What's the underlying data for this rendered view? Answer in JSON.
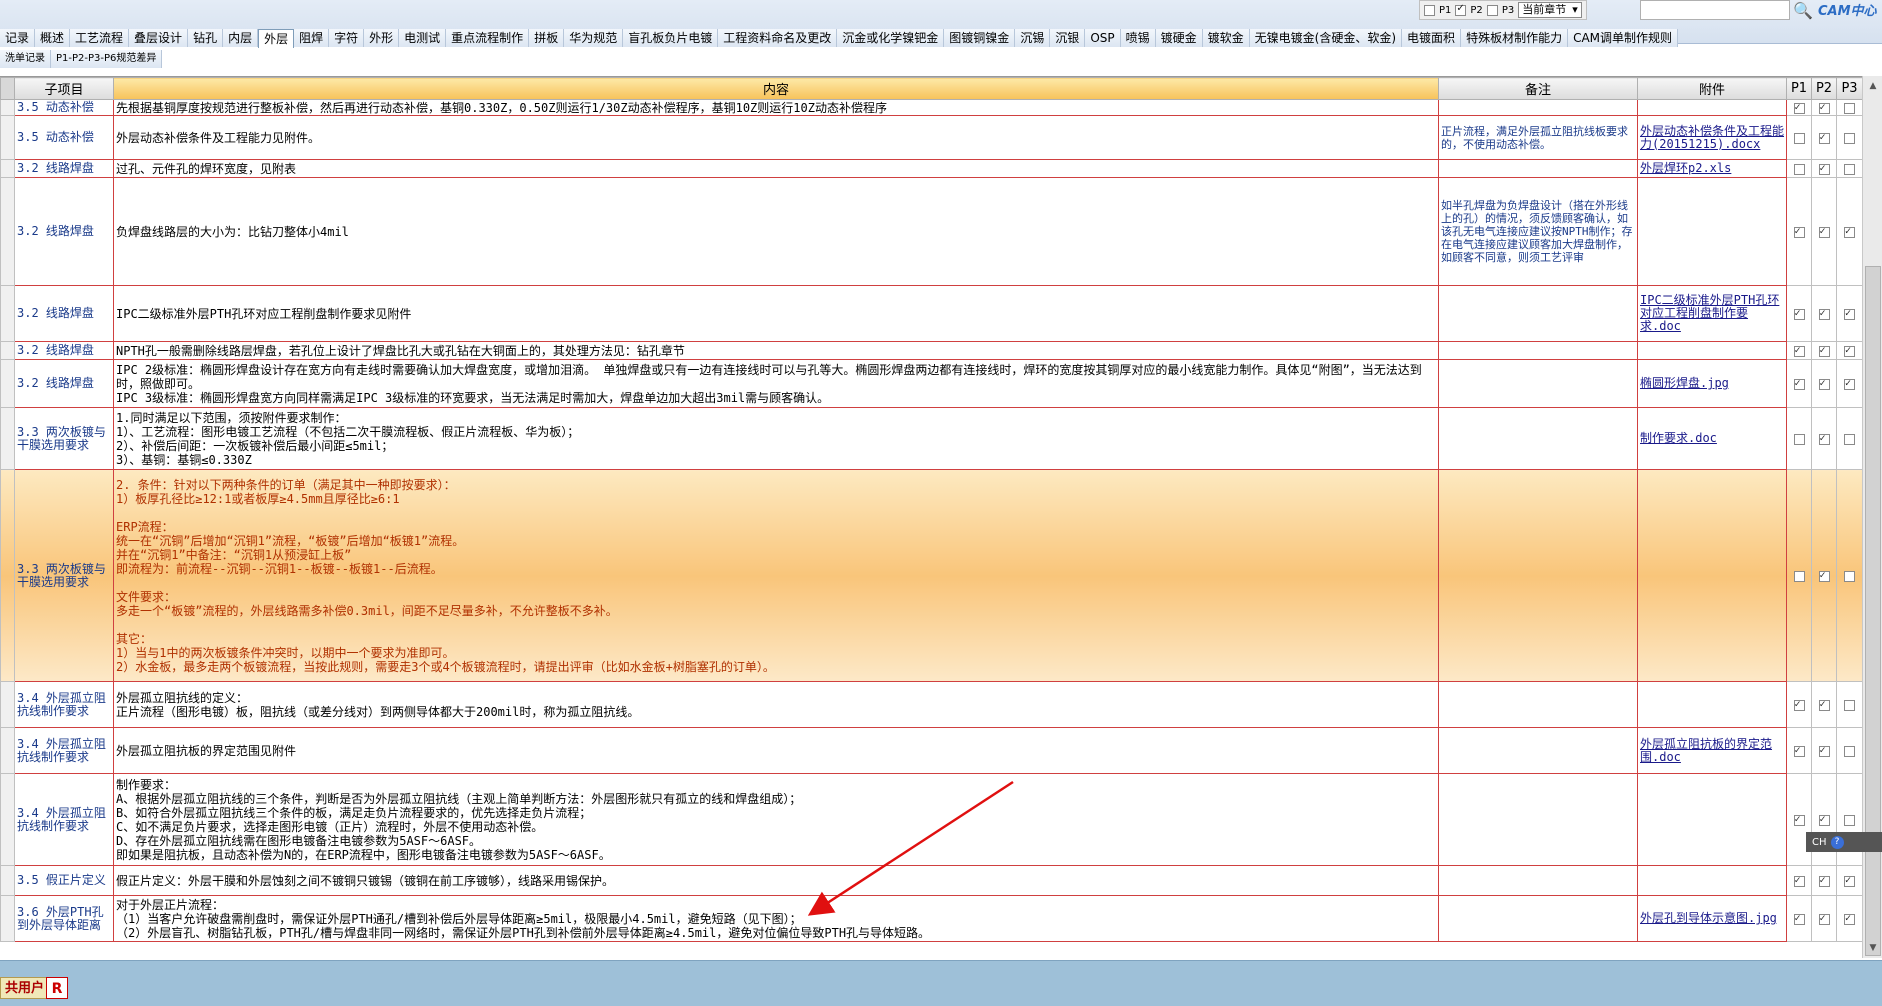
{
  "toolbar": {
    "p1_label": "P1",
    "p2_label": "P2",
    "p3_label": "P3",
    "p1_checked": false,
    "p2_checked": true,
    "p3_checked": false,
    "chapter_select": "当前章节",
    "logo_text": "CAM中心"
  },
  "tabs_row1": [
    "记录",
    "概述",
    "工艺流程",
    "叠层设计",
    "钻孔",
    "内层",
    "外层",
    "阻焊",
    "字符",
    "外形",
    "电测试",
    "重点流程制作",
    "拼板",
    "华为规范",
    "盲孔板负片电镀",
    "工程资料命名及更改",
    "沉金或化学镍钯金",
    "图镀铜镍金",
    "沉锡",
    "沉银",
    "OSP",
    "喷锡",
    "镀硬金",
    "镀软金",
    "无镍电镀金(含硬金、软金)",
    "电镀面积",
    "特殊板材制作能力",
    "CAM调单制作规则"
  ],
  "tabs_row1_active": "外层",
  "tabs_row2": [
    "洗单记录",
    "P1-P2-P3-P6规范差异"
  ],
  "table": {
    "headers": {
      "sub": "子项目",
      "content": "内容",
      "note": "备注",
      "attachment": "附件",
      "p1": "P1",
      "p2": "P2",
      "p3": "P3"
    },
    "rows": [
      {
        "sub": "3.5 动态补偿",
        "content": "先根据基铜厚度按规范进行整板补偿，然后再进行动态补偿，基铜0.330Z，0.50Z则运行1/30Z动态补偿程序，基铜10Z则运行10Z动态补偿程序",
        "note": "",
        "attachment": "",
        "p1": true,
        "p2": true,
        "p3": false
      },
      {
        "sub": "3.5 动态补偿",
        "content": "外层动态补偿条件及工程能力见附件。",
        "note": "正片流程，满足外层孤立阻抗线板要求的，不使用动态补偿。",
        "attachment": "外层动态补偿条件及工程能力(20151215).docx",
        "p1": false,
        "p2": true,
        "p3": false
      },
      {
        "sub": "3.2 线路焊盘",
        "content": "过孔、元件孔的焊环宽度，见附表",
        "note": "",
        "attachment": "外层焊环p2.xls",
        "p1": false,
        "p2": true,
        "p3": false
      },
      {
        "sub": "3.2 线路焊盘",
        "content": "负焊盘线路层的大小为：比钻刀整体小4mil",
        "note": "如半孔焊盘为负焊盘设计（搭在外形线上的孔）的情况，须反馈顾客确认，如该孔无电气连接应建议按NPTH制作；存在电气连接应建议顾客加大焊盘制作，如顾客不同意，则须工艺评审",
        "attachment": "",
        "p1": true,
        "p2": true,
        "p3": true
      },
      {
        "sub": "3.2 线路焊盘",
        "content": "IPC二级标准外层PTH孔环对应工程削盘制作要求见附件",
        "note": "",
        "attachment": "IPC二级标准外层PTH孔环对应工程削盘制作要求.doc",
        "p1": true,
        "p2": true,
        "p3": true
      },
      {
        "sub": "3.2 线路焊盘",
        "content": "NPTH孔一般需删除线路层焊盘，若孔位上设计了焊盘比孔大或孔钻在大铜面上的，其处理方法见：钻孔章节",
        "note": "",
        "attachment": "",
        "p1": true,
        "p2": true,
        "p3": true
      },
      {
        "sub": "3.2 线路焊盘",
        "content": "IPC 2级标准：椭圆形焊盘设计存在宽方向有走线时需要确认加大焊盘宽度，或增加泪滴。 单独焊盘或只有一边有连接线时可以与孔等大。椭圆形焊盘两边都有连接线时，焊环的宽度按其铜厚对应的最小线宽能力制作。具体见“附图”，当无法达到时，照做即可。\nIPC 3级标准：椭圆形焊盘宽方向同样需满足IPC 3级标准的环宽要求，当无法满足时需加大，焊盘单边加大超出3mil需与顾客确认。",
        "note": "",
        "attachment": "椭圆形焊盘.jpg",
        "p1": true,
        "p2": true,
        "p3": true
      },
      {
        "sub": "3.3 两次板镀与干膜选用要求",
        "content": "1.同时满足以下范围，须按附件要求制作：\n1）、工艺流程：图形电镀工艺流程（不包括二次干膜流程板、假正片流程板、华为板）；\n2）、补偿后间距：一次板镀补偿后最小间距≤5mil；\n3）、基铜：基铜≤0.330Z",
        "note": "",
        "attachment": "制作要求.doc",
        "p1": false,
        "p2": true,
        "p3": false
      },
      {
        "sub": "3.3 两次板镀与干膜选用要求",
        "content": "2. 条件：针对以下两种条件的订单（满足其中一种即按要求）：\n1）板厚孔径比≥12:1或者板厚≥4.5mm且厚径比≥6:1\n\nERP流程：\n统一在“沉铜”后增加“沉铜1”流程，“板镀”后增加“板镀1”流程。\n并在“沉铜1”中备注：“沉铜1从预浸缸上板”\n即流程为：前流程--沉铜--沉铜1--板镀--板镀1--后流程。\n\n文件要求：\n多走一个“板镀”流程的，外层线路需多补偿0.3mil，间距不足尽量多补，不允许整板不多补。\n\n其它：\n1）当与1中的两次板镀条件冲突时，以期中一个要求为准即可。\n2）水金板，最多走两个板镀流程，当按此规则，需要走3个或4个板镀流程时，请提出评审（比如水金板+树脂塞孔的订单）。",
        "note": "",
        "attachment": "",
        "p1": false,
        "p2": true,
        "p3": false,
        "highlight": true
      },
      {
        "sub": "3.4 外层孤立阻抗线制作要求",
        "content": "外层孤立阻抗线的定义：\n正片流程（图形电镀）板，阻抗线（或差分线对）到两侧导体都大于200mil时，称为孤立阻抗线。",
        "note": "",
        "attachment": "",
        "p1": true,
        "p2": true,
        "p3": false
      },
      {
        "sub": "3.4 外层孤立阻抗线制作要求",
        "content": "外层孤立阻抗板的界定范围见附件",
        "note": "",
        "attachment": "外层孤立阻抗板的界定范围.doc",
        "p1": true,
        "p2": true,
        "p3": false
      },
      {
        "sub": "3.4 外层孤立阻抗线制作要求",
        "content": "制作要求：\nA、根据外层孤立阻抗线的三个条件，判断是否为外层孤立阻抗线（主观上简单判断方法：外层图形就只有孤立的线和焊盘组成）；\nB、如符合外层孤立阻抗线三个条件的板，满足走负片流程要求的，优先选择走负片流程；\nC、如不满足负片要求，选择走图形电镀（正片）流程时，外层不使用动态补偿。\nD、存在外层孤立阻抗线需在图形电镀备注电镀参数为5ASF～6ASF。\n即如果是阻抗板，且动态补偿为N的，在ERP流程中，图形电镀备注电镀参数为5ASF～6ASF。",
        "note": "",
        "attachment": "",
        "p1": true,
        "p2": true,
        "p3": false
      },
      {
        "sub": "3.5 假正片定义",
        "content": "假正片定义：外层干膜和外层蚀刻之间不镀铜只镀锡（镀铜在前工序镀够），线路采用锡保护。",
        "note": "",
        "attachment": "",
        "p1": true,
        "p2": true,
        "p3": true
      },
      {
        "sub": "3.6 外层PTH孔到外层导体距离",
        "content": "对于外层正片流程：\n（1）当客户允许破盘需削盘时，需保证外层PTH通孔/槽到补偿后外层导体距离≥5mil，极限最小4.5mil，避免短路（见下图）；\n（2）外层盲孔、树脂钻孔板，PTH孔/槽与焊盘非同一网络时，需保证外层PTH孔到补偿前外层导体距离≥4.5mil，避免对位偏位导致PTH孔与导体短路。",
        "note": "",
        "attachment": "外层孔到导体示意图.jpg",
        "p1": true,
        "p2": true,
        "p3": true
      }
    ]
  },
  "status": {
    "user": "共用户",
    "r": "R"
  },
  "ime": {
    "label": "CH",
    "help": "?"
  }
}
